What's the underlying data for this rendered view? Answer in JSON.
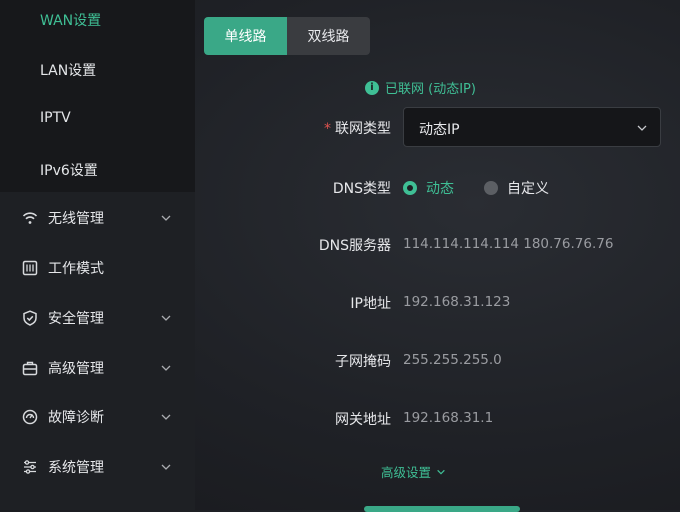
{
  "sidebar": {
    "sub_items": [
      {
        "label": "WAN设置"
      },
      {
        "label": "LAN设置"
      },
      {
        "label": "IPTV"
      },
      {
        "label": "IPv6设置"
      }
    ],
    "nav_items": [
      {
        "label": "无线管理",
        "icon": "wifi-icon"
      },
      {
        "label": "工作模式",
        "icon": "mode-icon"
      },
      {
        "label": "安全管理",
        "icon": "shield-icon"
      },
      {
        "label": "高级管理",
        "icon": "toolbox-icon"
      },
      {
        "label": "故障诊断",
        "icon": "diagnose-icon"
      },
      {
        "label": "系统管理",
        "icon": "settings-sliders-icon"
      }
    ]
  },
  "tabs": [
    {
      "label": "单线路"
    },
    {
      "label": "双线路"
    }
  ],
  "status": {
    "text": "已联网 (动态IP)",
    "info": "i"
  },
  "form": {
    "connection_type": {
      "required": "*",
      "label": "联网类型",
      "value": "动态IP"
    },
    "dns_type": {
      "label": "DNS类型",
      "option_dynamic": "动态",
      "option_custom": "自定义"
    },
    "dns_servers": {
      "label": "DNS服务器",
      "value": "114.114.114.114 180.76.76.76"
    },
    "ip_address": {
      "label": "IP地址",
      "value": "192.168.31.123"
    },
    "subnet_mask": {
      "label": "子网掩码",
      "value": "255.255.255.0"
    },
    "gateway": {
      "label": "网关地址",
      "value": "192.168.31.1"
    }
  },
  "advanced": {
    "label": "高级设置"
  },
  "colors": {
    "accent": "#3fbf95",
    "tab_active": "#3aa887",
    "required": "#e0534f"
  }
}
